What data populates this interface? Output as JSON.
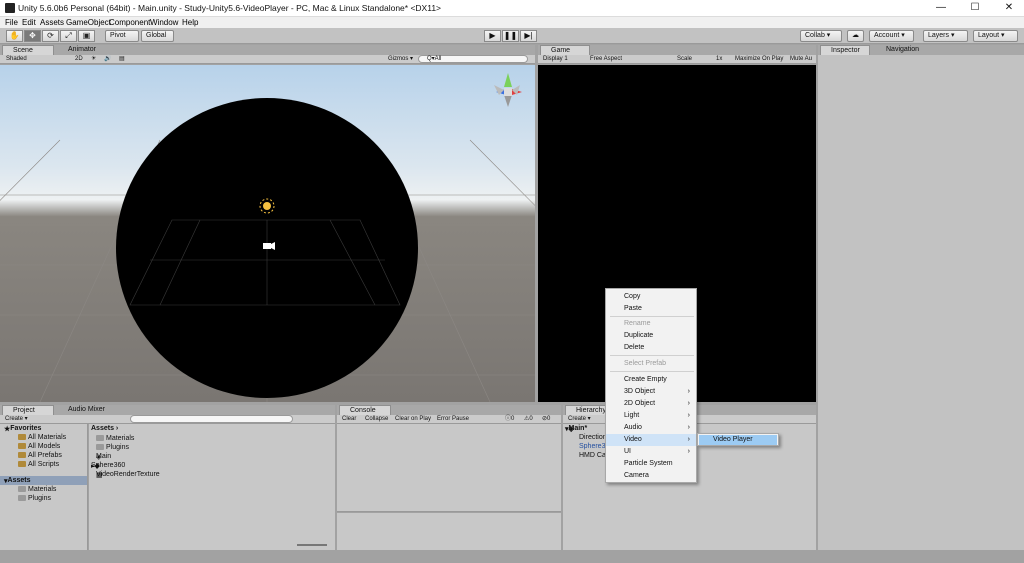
{
  "title": "Unity 5.6.0b6 Personal (64bit) - Main.unity - Study-Unity5.6-VideoPlayer - PC, Mac & Linux Standalone* <DX11>",
  "window_controls": [
    "—",
    "☐",
    "✕"
  ],
  "menu": [
    "File",
    "Edit",
    "Assets",
    "GameObject",
    "Component",
    "Window",
    "Help"
  ],
  "toolbar": {
    "pivot": "Pivot",
    "global": "Global",
    "collab": "Collab ▾",
    "account": "Account",
    "layers": "Layers",
    "layout": "Layout",
    "icons": [
      "hand-icon",
      "move-icon",
      "rotate-icon",
      "scale-icon",
      "rect-icon",
      "play-icon",
      "pause-icon",
      "step-icon",
      "cloud-icon"
    ]
  },
  "scene": {
    "tab_scene": "Scene",
    "tab_animator": "Animator",
    "shaded": "Shaded",
    "mode2d": "2D",
    "gizmos": "Gizmos ▾",
    "search_placeholder": "Q▾All"
  },
  "game": {
    "tab": "Game",
    "display": "Display 1",
    "aspect": "Free Aspect",
    "scale": "Scale",
    "scale_value": "1x",
    "maximize": "Maximize On Play",
    "mute": "Mute Au"
  },
  "inspector": {
    "tab": "Inspector",
    "nav_tab": "Navigation"
  },
  "project": {
    "tab": "Project",
    "tab_audio": "Audio Mixer",
    "create": "Create ▾",
    "favorites": "Favorites",
    "fav_items": [
      "All Materials",
      "All Models",
      "All Prefabs",
      "All Scripts"
    ],
    "assets_label": "Assets",
    "asset_folders": [
      "Materials",
      "Plugins"
    ],
    "breadcrumb": "Assets ›",
    "files": [
      "Materials",
      "Plugins",
      "Main",
      "Sphere360",
      "VideoRenderTexture"
    ]
  },
  "console": {
    "tab": "Console",
    "buttons": [
      "Clear",
      "Collapse",
      "Clear on Play",
      "Error Pause"
    ],
    "counts": [
      "0",
      "0",
      "0"
    ]
  },
  "hierarchy": {
    "tab": "Hierarchy",
    "create": "Create ▾",
    "root": "Main*",
    "items": [
      "Direction",
      "Sphere3",
      "HMD Ca"
    ]
  },
  "context_menu": {
    "items": [
      "Copy",
      "Paste",
      "Rename",
      "Duplicate",
      "Delete",
      "Select Prefab",
      "Create Empty",
      "3D Object",
      "2D Object",
      "Light",
      "Audio",
      "Video",
      "UI",
      "Particle System",
      "Camera"
    ],
    "submenu_item": "Video Player"
  },
  "colors": {
    "accent": "#9ccbf3",
    "scene_bg": "#787878",
    "sky": "#b8d0e6"
  }
}
